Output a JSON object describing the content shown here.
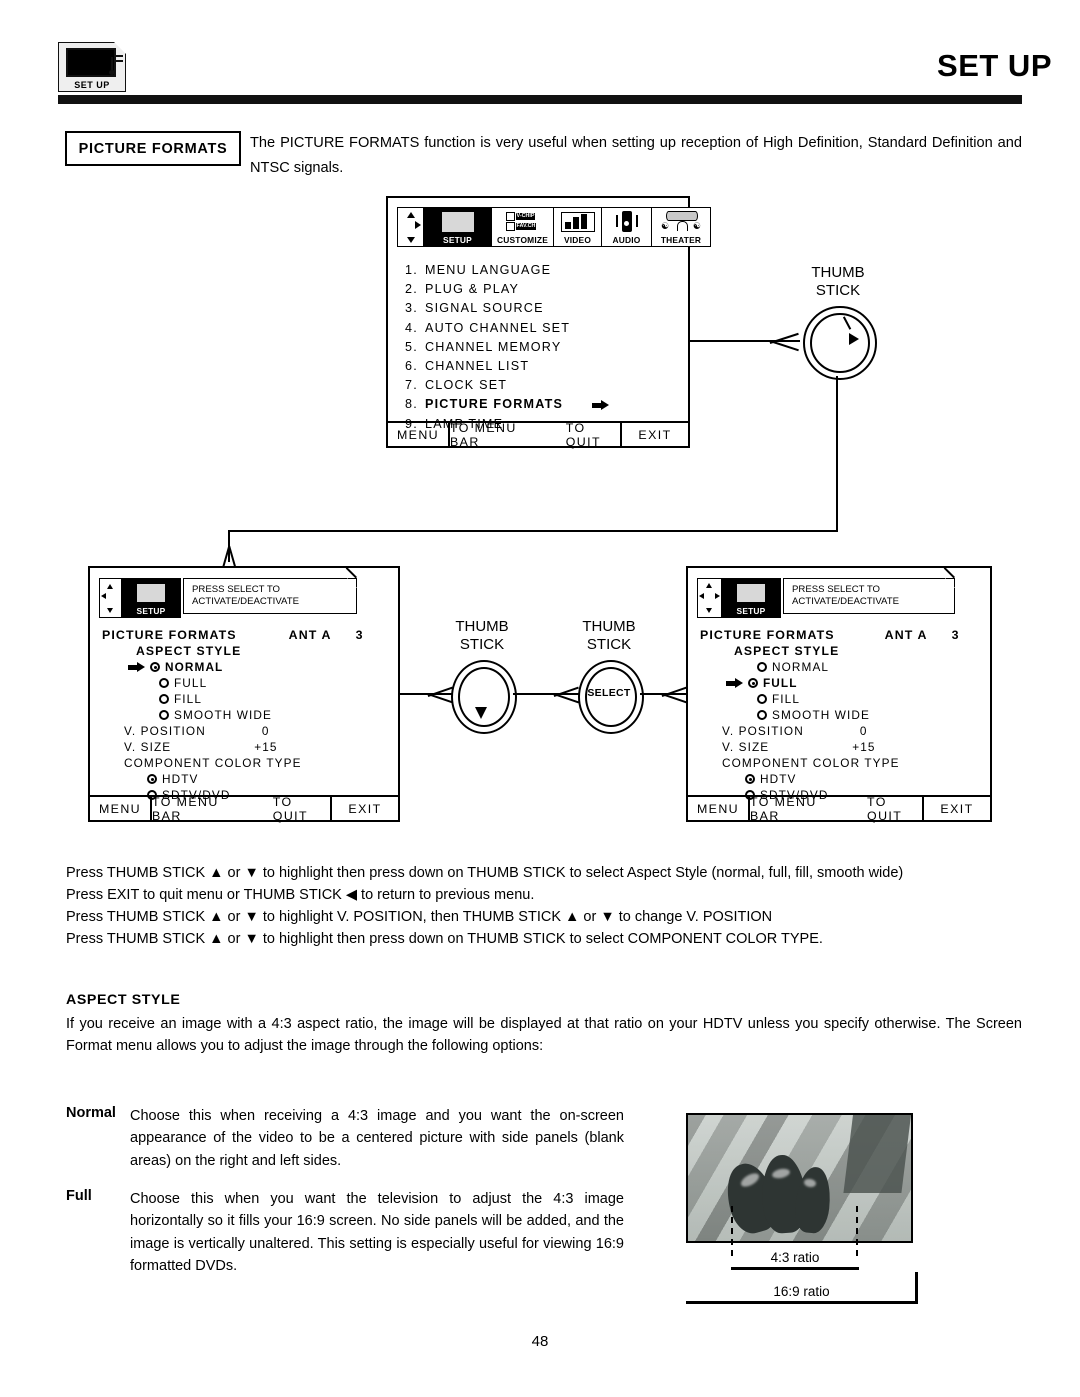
{
  "header": {
    "icon_label": "SET UP",
    "title": "SET UP"
  },
  "intro": {
    "callout_label": "PICTURE FORMATS",
    "text": "The PICTURE FORMATS function is very useful when setting up reception of High Definition, Standard Definition and NTSC signals."
  },
  "menu_bar": {
    "tabs": [
      {
        "label": "SETUP",
        "icon": "tv-icon",
        "selected": true
      },
      {
        "label": "CUSTOMIZE",
        "icon": "v-chip-icon",
        "selected": false
      },
      {
        "label": "VIDEO",
        "icon": "video-bars-icon",
        "selected": false
      },
      {
        "label": "AUDIO",
        "icon": "speaker-icon",
        "selected": false
      },
      {
        "label": "THEATER",
        "icon": "theater-icon",
        "selected": false
      }
    ],
    "vchip_line1": "V-CHIP",
    "vchip_line2": "FAV.CH"
  },
  "setup_menu": {
    "items": [
      {
        "num": "1.",
        "label": "MENU LANGUAGE",
        "selected": false
      },
      {
        "num": "2.",
        "label": "PLUG & PLAY",
        "selected": false
      },
      {
        "num": "3.",
        "label": "SIGNAL SOURCE",
        "selected": false
      },
      {
        "num": "4.",
        "label": "AUTO CHANNEL SET",
        "selected": false
      },
      {
        "num": "5.",
        "label": "CHANNEL MEMORY",
        "selected": false
      },
      {
        "num": "6.",
        "label": "CHANNEL LIST",
        "selected": false
      },
      {
        "num": "7.",
        "label": "CLOCK SET",
        "selected": false
      },
      {
        "num": "8.",
        "label": "PICTURE FORMATS",
        "selected": true
      },
      {
        "num": "9.",
        "label": "LAMP TIME",
        "selected": false
      }
    ],
    "footer": {
      "menu": "MENU",
      "to_menu_bar": "TO MENU BAR",
      "to_quit": "TO QUIT",
      "exit": "EXIT"
    }
  },
  "balloon": {
    "line1": "PRESS SELECT TO",
    "line2": "ACTIVATE/DEACTIVATE"
  },
  "picture_formats_left": {
    "title": "PICTURE FORMATS",
    "source": "ANT A",
    "channel": "3",
    "aspect_style_label": "ASPECT STYLE",
    "aspect_options": [
      {
        "label": "NORMAL",
        "selected": true,
        "cursor": true
      },
      {
        "label": "FULL",
        "selected": false,
        "cursor": false
      },
      {
        "label": "FILL",
        "selected": false,
        "cursor": false
      },
      {
        "label": "SMOOTH WIDE",
        "selected": false,
        "cursor": false
      }
    ],
    "v_position_label": "V. POSITION",
    "v_position_value": "0",
    "v_size_label": "V. SIZE",
    "v_size_value": "+15",
    "component_color_label": "COMPONENT COLOR TYPE",
    "component_options": [
      {
        "label": "HDTV",
        "selected": true
      },
      {
        "label": "SDTV/DVD",
        "selected": false
      }
    ],
    "footer": {
      "menu": "MENU",
      "to_menu_bar": "TO MENU BAR",
      "to_quit": "TO QUIT",
      "exit": "EXIT"
    }
  },
  "picture_formats_right": {
    "title": "PICTURE FORMATS",
    "source": "ANT A",
    "channel": "3",
    "aspect_style_label": "ASPECT STYLE",
    "aspect_options": [
      {
        "label": "NORMAL",
        "selected": false,
        "cursor": false
      },
      {
        "label": "FULL",
        "selected": true,
        "cursor": true
      },
      {
        "label": "FILL",
        "selected": false,
        "cursor": false
      },
      {
        "label": "SMOOTH WIDE",
        "selected": false,
        "cursor": false
      }
    ],
    "v_position_label": "V. POSITION",
    "v_position_value": "0",
    "v_size_label": "V. SIZE",
    "v_size_value": "+15",
    "component_color_label": "COMPONENT COLOR TYPE",
    "component_options": [
      {
        "label": "HDTV",
        "selected": true
      },
      {
        "label": "SDTV/DVD",
        "selected": false
      }
    ],
    "footer": {
      "menu": "MENU",
      "to_menu_bar": "TO MENU BAR",
      "to_quit": "TO QUIT",
      "exit": "EXIT"
    }
  },
  "controls": {
    "thumb_stick_top": {
      "line1": "THUMB",
      "line2": "STICK"
    },
    "thumb_stick_1": {
      "line1": "THUMB",
      "line2": "STICK"
    },
    "thumb_stick_2": {
      "line1": "THUMB",
      "line2": "STICK"
    },
    "select_label": "SELECT"
  },
  "instructions": [
    "Press THUMB STICK ▲ or ▼ to highlight then press down on THUMB STICK to select Aspect Style (normal, full, fill, smooth wide)",
    "Press EXIT to quit menu or THUMB STICK ◀ to return to previous menu.",
    "Press THUMB STICK ▲ or ▼ to highlight V. POSITION, then THUMB STICK ▲ or ▼ to change V. POSITION",
    "Press THUMB STICK ▲ or ▼ to highlight then press down on THUMB STICK to select COMPONENT COLOR TYPE."
  ],
  "aspect_section": {
    "heading": "ASPECT STYLE",
    "paragraph": "If you receive an image with a 4:3 aspect ratio, the image will be displayed at that ratio on your HDTV unless you specify otherwise. The Screen Format menu allows you to adjust the image through the following options:",
    "definitions": [
      {
        "term": "Normal",
        "text": "Choose this when receiving a 4:3 image and you want the on-screen appearance of the video to be a centered picture with side panels (blank areas) on the right and left sides."
      },
      {
        "term": "Full",
        "text": "Choose this when you want the television to adjust the 4:3 image horizontally so it fills your 16:9 screen. No side panels will be added, and the image is vertically unaltered. This setting is especially useful for viewing 16:9 formatted DVDs."
      }
    ]
  },
  "figure": {
    "ratio_43": "4:3 ratio",
    "ratio_169": "16:9 ratio"
  },
  "page_number": "48"
}
